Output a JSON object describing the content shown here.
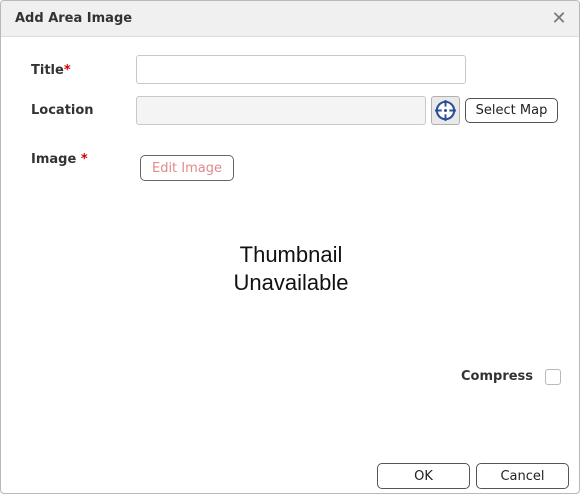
{
  "dialog": {
    "title": "Add Area Image",
    "close_glyph": "✕"
  },
  "form": {
    "title_label": "Title",
    "title_required": "*",
    "title_value": "",
    "location_label": "Location",
    "location_value": "",
    "locate_icon": "crosshair-icon",
    "select_map_label": "Select Map",
    "image_label": "Image",
    "image_required": "*",
    "edit_image_label": "Edit Image",
    "thumbnail_line1": "Thumbnail",
    "thumbnail_line2": "Unavailable",
    "compress_label": "Compress",
    "compress_checked": false
  },
  "footer": {
    "ok_label": "OK",
    "cancel_label": "Cancel"
  },
  "colors": {
    "required": "#cc0000",
    "edit_image_text": "#e08a8a",
    "locate_icon": "#2b4f9a"
  }
}
